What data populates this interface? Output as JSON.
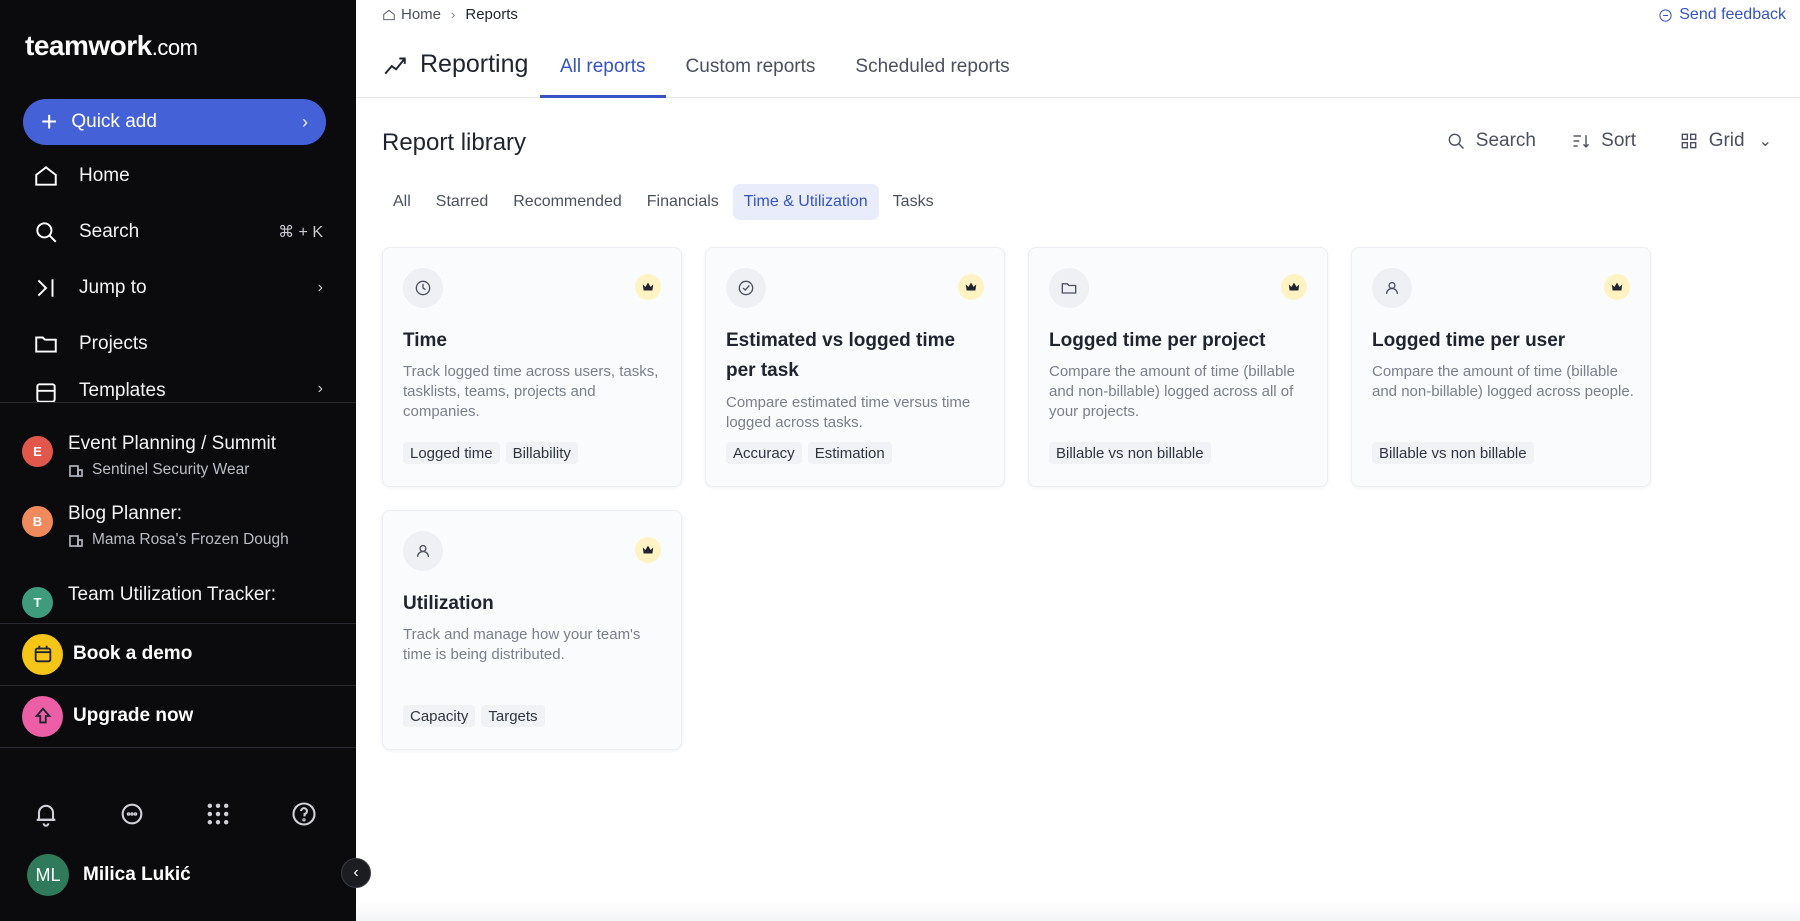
{
  "sidebar": {
    "logo_main": "teamwork",
    "logo_suffix": ".com",
    "quick_add": "Quick add",
    "nav": {
      "home": "Home",
      "search": "Search",
      "search_shortcut": "⌘ + K",
      "jump_to": "Jump to",
      "projects": "Projects",
      "templates": "Templates"
    },
    "recent": [
      {
        "initial": "E",
        "title": "Event Planning / Summit",
        "client": "Sentinel Security Wear",
        "color": "#e2574c"
      },
      {
        "initial": "B",
        "title": "Blog Planner:",
        "client": "Mama Rosa's Frozen Dough",
        "color": "#f08a5d"
      },
      {
        "initial": "T",
        "title": "Team Utilization Tracker:",
        "client": "",
        "color": "#3e9b7c"
      }
    ],
    "book_demo": "Book a demo",
    "upgrade": "Upgrade now",
    "user": {
      "initials": "ML",
      "name": "Milica Lukić"
    }
  },
  "breadcrumb": {
    "home": "Home",
    "current": "Reports"
  },
  "send_feedback": "Send feedback",
  "page_title": "Reporting",
  "tabs": [
    {
      "label": "All reports",
      "active": true
    },
    {
      "label": "Custom reports",
      "active": false
    },
    {
      "label": "Scheduled reports",
      "active": false
    }
  ],
  "library_title": "Report library",
  "tools": {
    "search": "Search",
    "sort": "Sort",
    "view": "Grid"
  },
  "filters": [
    {
      "label": "All",
      "active": false
    },
    {
      "label": "Starred",
      "active": false
    },
    {
      "label": "Recommended",
      "active": false
    },
    {
      "label": "Financials",
      "active": false
    },
    {
      "label": "Time & Utilization",
      "active": true
    },
    {
      "label": "Tasks",
      "active": false
    }
  ],
  "cards": [
    {
      "icon": "clock-icon",
      "title": "Time",
      "description": "Track logged time across users, tasks, tasklists, teams, projects and companies.",
      "tags": [
        "Logged time",
        "Billability"
      ]
    },
    {
      "icon": "check-circle-icon",
      "title": "Estimated vs logged time per task",
      "description": "Compare estimated time versus time logged across tasks.",
      "tags": [
        "Accuracy",
        "Estimation"
      ]
    },
    {
      "icon": "folder-icon",
      "title": "Logged time per project",
      "description": "Compare the amount of time (billable and non-billable) logged across all of your projects.",
      "tags": [
        "Billable vs non billable"
      ]
    },
    {
      "icon": "user-icon",
      "title": "Logged time per user",
      "description": "Compare the amount of time (billable and non-billable) logged across people.",
      "tags": [
        "Billable vs non billable"
      ]
    },
    {
      "icon": "user-icon",
      "title": "Utilization",
      "description": "Track and manage how your team's time is being distributed.",
      "tags": [
        "Capacity",
        "Targets"
      ]
    }
  ],
  "colors": {
    "accent": "#4461d7",
    "link": "#3553c4",
    "sidebar_bg": "#0b0b0d",
    "demo": "#f5c518",
    "upgrade": "#ec5fa6",
    "premium_badge": "#fff3c4"
  }
}
